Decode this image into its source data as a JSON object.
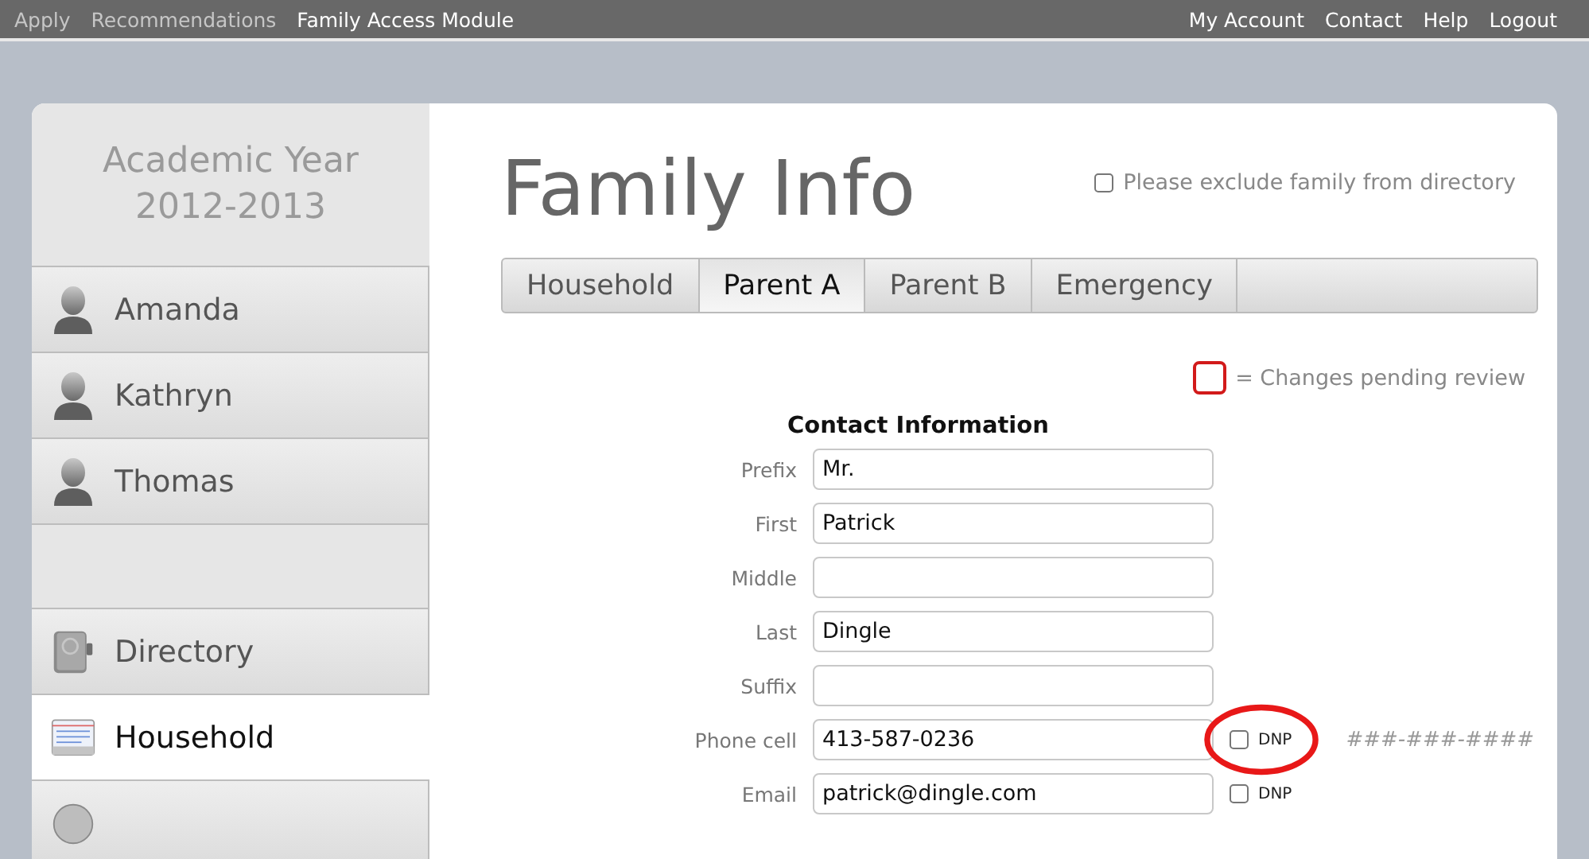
{
  "top_nav": {
    "left": [
      {
        "label": "Apply",
        "selected": false
      },
      {
        "label": "Recommendations",
        "selected": false
      },
      {
        "label": "Family Access Module",
        "selected": true
      }
    ],
    "right": [
      "My Account",
      "Contact",
      "Help",
      "Logout"
    ]
  },
  "sidebar": {
    "year_title": "Academic Year",
    "year": "2012-2013",
    "items": [
      {
        "kind": "person",
        "label": "Amanda",
        "selected": false
      },
      {
        "kind": "person",
        "label": "Kathryn",
        "selected": false
      },
      {
        "kind": "person",
        "label": "Thomas",
        "selected": false
      },
      {
        "kind": "spacer"
      },
      {
        "kind": "directory",
        "label": "Directory",
        "selected": false
      },
      {
        "kind": "household",
        "label": "Household",
        "selected": true
      },
      {
        "kind": "info",
        "selected": false
      }
    ]
  },
  "page_title": "Family Info",
  "exclude_option": {
    "label": "Please exclude family from directory",
    "checked": false
  },
  "tabs": [
    {
      "label": "Household",
      "selected": false
    },
    {
      "label": "Parent A",
      "selected": true
    },
    {
      "label": "Parent B",
      "selected": false
    },
    {
      "label": "Emergency",
      "selected": false
    }
  ],
  "legend": "= Changes pending review",
  "section_title": "Contact Information",
  "fields": [
    {
      "label": "Prefix",
      "value": "Mr."
    },
    {
      "label": "First",
      "value": "Patrick"
    },
    {
      "label": "Middle"
    },
    {
      "label": "Last",
      "value": "Dingle"
    },
    {
      "label": "Suffix"
    },
    {
      "label": "Phone cell",
      "value": "413-587-0236",
      "dnp": {
        "label": "DNP",
        "checked": false
      },
      "highlighted": true,
      "hint": "###-###-####"
    },
    {
      "label": "Email",
      "value": "patrick@dingle.com",
      "dnp": {
        "label": "DNP",
        "checked": false
      }
    }
  ]
}
